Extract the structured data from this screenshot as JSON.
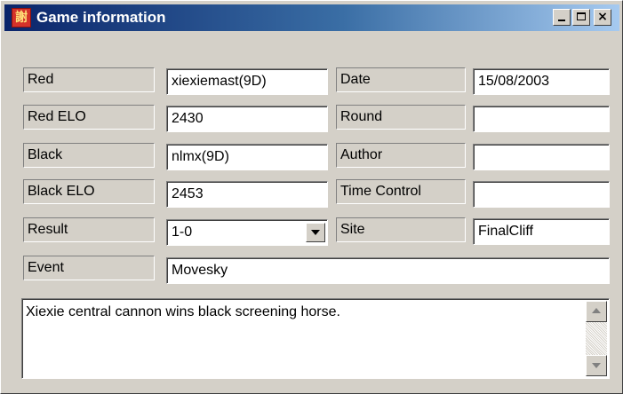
{
  "window": {
    "title": "Game information",
    "icon_glyph": "謝",
    "controls": {
      "minimize": "minimize",
      "maximize": "maximize",
      "close": "×"
    }
  },
  "fields": {
    "red": {
      "label": "Red",
      "value": "xiexiemast(9D)"
    },
    "red_elo": {
      "label": "Red ELO",
      "value": "2430"
    },
    "black": {
      "label": "Black",
      "value": "nlmx(9D)"
    },
    "black_elo": {
      "label": "Black ELO",
      "value": "2453"
    },
    "result": {
      "label": "Result",
      "value": "1-0"
    },
    "event": {
      "label": "Event",
      "value": "Movesky"
    },
    "date": {
      "label": "Date",
      "value": "15/08/2003"
    },
    "round": {
      "label": "Round",
      "value": ""
    },
    "author": {
      "label": "Author",
      "value": ""
    },
    "time_control": {
      "label": "Time Control",
      "value": ""
    },
    "site": {
      "label": "Site",
      "value": "FinalCliff"
    }
  },
  "notes": {
    "text": "Xiexie central cannon wins black screening horse."
  },
  "icons": [
    "app-icon",
    "minimize-icon",
    "maximize-icon",
    "close-icon",
    "dropdown-arrow-icon",
    "scroll-up-icon",
    "scroll-down-icon"
  ]
}
